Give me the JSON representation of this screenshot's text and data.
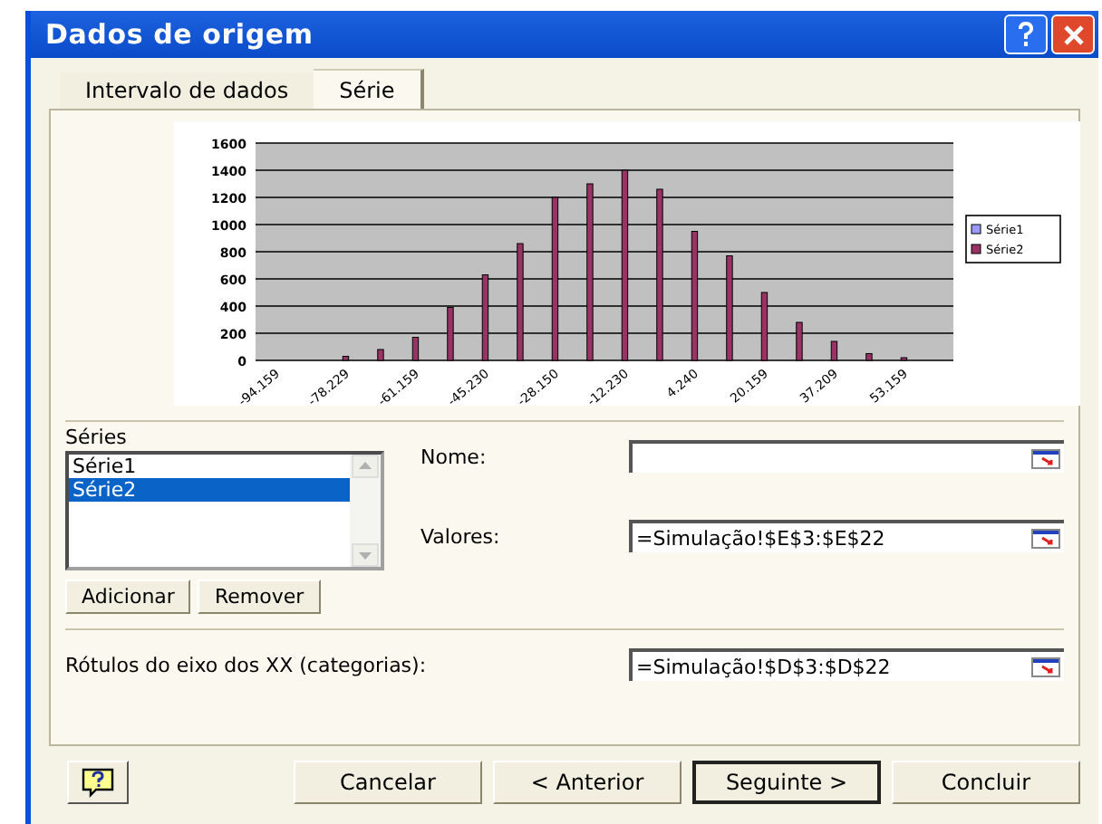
{
  "window": {
    "title": "Dados de origem"
  },
  "tabs": [
    {
      "label": "Intervalo de dados",
      "selected": false
    },
    {
      "label": "Série",
      "selected": true
    }
  ],
  "chart": {
    "chart_data": {
      "type": "bar",
      "categories": [
        "-94.159",
        null,
        "-78.229",
        null,
        "-61.159",
        null,
        "-45.230",
        null,
        "-28.150",
        null,
        "-12.230",
        null,
        "4.240",
        null,
        "20.159",
        null,
        "37.209",
        null,
        "53.159",
        null
      ],
      "grid": true,
      "series": [
        {
          "name": "Série1",
          "color": "#9999ff",
          "values": [
            null,
            null,
            null,
            null,
            null,
            null,
            null,
            null,
            null,
            null,
            null,
            null,
            null,
            null,
            null,
            null,
            null,
            null,
            null,
            null
          ]
        },
        {
          "name": "Série2",
          "color": "#993366",
          "values": [
            0,
            0,
            30,
            80,
            170,
            390,
            630,
            860,
            1200,
            1300,
            1400,
            1260,
            950,
            770,
            500,
            280,
            140,
            50,
            20,
            0
          ]
        }
      ],
      "ylim": [
        0,
        1600
      ],
      "yticks": [
        0,
        200,
        400,
        600,
        800,
        1000,
        1200,
        1400,
        1600
      ]
    }
  },
  "series_list": {
    "label": "Séries",
    "items": [
      {
        "label": "Série1",
        "selected": false
      },
      {
        "label": "Série2",
        "selected": true
      }
    ]
  },
  "name_field": {
    "label": "Nome:"
  },
  "values_field": {
    "label": "Valores:",
    "value": "=Simulação!$E$3:$E$22"
  },
  "list_buttons": [
    "Adicionar",
    "Remover"
  ],
  "categories_field": {
    "label": "Rótulos do eixo dos XX (categorias):",
    "value": "=Simulação!$D$3:$D$22"
  },
  "footer_buttons": [
    {
      "label": "Cancelar",
      "default": false
    },
    {
      "label": "< Anterior",
      "default": false
    },
    {
      "label": "Seguinte >",
      "default": true
    },
    {
      "label": "Concluir",
      "default": false
    }
  ]
}
